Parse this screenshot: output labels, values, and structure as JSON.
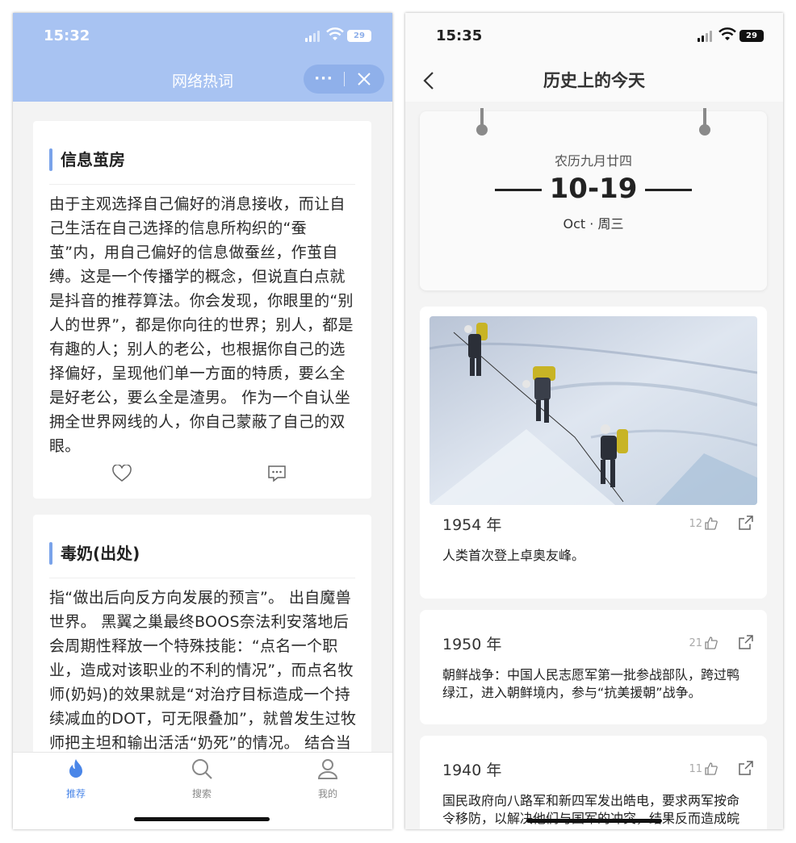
{
  "left_phone": {
    "status": {
      "time": "15:32",
      "battery": "29"
    },
    "header": {
      "title": "网络热词"
    },
    "capsule": {
      "more_label": "···"
    },
    "cards": [
      {
        "title": "信息茧房",
        "body": "由于主观选择自己偏好的消息接收，而让自己生活在自己选择的信息所构织的“蚕茧”内，用自己偏好的信息做蚕丝，作茧自缚。这是一个传播学的概念，但说直白点就是抖音的推荐算法。你会发现，你眼里的“别人的世界”，都是你向往的世界；别人，都是有趣的人；别人的老公，也根据你自己的选择偏好，呈现他们单一方面的特质，要么全是好老公，要么全是渣男。 作为一个自认坐拥全世界网线的人，你自己蒙蔽了自己的双眼。"
      },
      {
        "title": "毒奶(出处)",
        "body": "指“做出后向反方向发展的预言”。 出自魔兽世界。 黑翼之巢最终BOOS奈法利安落地后会周期性释放一个特殊技能：“点名一个职业，造成对该职业的不利的情况”，而点名牧师(奶妈)的效果就是“对治疗目标造成一个持续减血的DOT，可无限叠加”，就曾发生过牧师把主坦和输出活活“奶死”的情况。 结合当"
      }
    ],
    "tabbar": [
      {
        "label": "推荐",
        "icon": "flame-icon",
        "active": true
      },
      {
        "label": "搜索",
        "icon": "search-icon",
        "active": false
      },
      {
        "label": "我的",
        "icon": "user-icon",
        "active": false
      }
    ]
  },
  "right_phone": {
    "status": {
      "time": "15:35",
      "battery": "29"
    },
    "navbar": {
      "title": "历史上的今天"
    },
    "calendar": {
      "lunar": "农历九月廿四",
      "date": "10-19",
      "weekday": "Oct · 周三"
    },
    "events": [
      {
        "year": "1954 年",
        "likes": "12",
        "text": "人类首次登上卓奥友峰。",
        "image": "mountain-climbers-photo"
      },
      {
        "year": "1950 年",
        "likes": "21",
        "text": "朝鲜战争：中国人民志愿军第一批参战部队，跨过鸭绿江，进入朝鲜境内，参与“抗美援朝”战争。"
      },
      {
        "year": "1940 年",
        "likes": "11",
        "text": "国民政府向八路军和新四军发出皓电，要求两军按命令移防，以解决他们与国军的冲突，结果反而造成皖南事变。"
      }
    ]
  },
  "colors": {
    "left_header": "#a8c3f2",
    "accent_blue": "#4a86e8",
    "title_bar": "#7aa3ea"
  }
}
